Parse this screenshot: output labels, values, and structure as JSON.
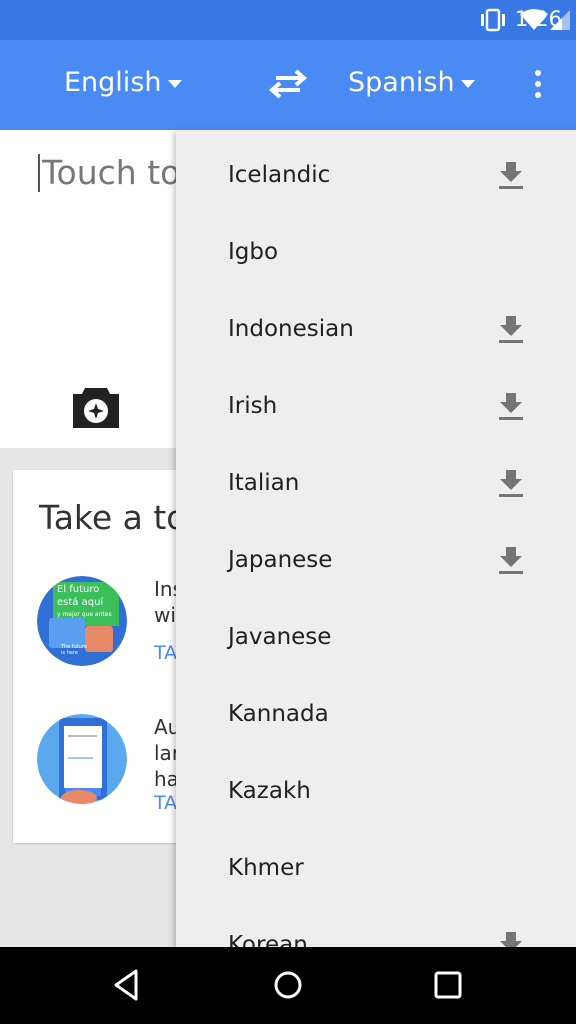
{
  "status_bar": {
    "time": "1:26",
    "icons": [
      "vibrate-icon",
      "wifi-icon",
      "cell-signal-icon",
      "battery-icon"
    ]
  },
  "app_bar": {
    "source_language": "English",
    "target_language": "Spanish",
    "icons": [
      "swap-icon",
      "more-vert-icon"
    ],
    "color": "#4a8af4"
  },
  "input": {
    "placeholder": "Touch to"
  },
  "tour": {
    "title": "Take a to",
    "items": [
      {
        "text": "Ins\nwi",
        "link": "TA",
        "thumb_text": [
          "El futuro",
          "está aquí",
          "y mejor que antes"
        ]
      },
      {
        "text": "Au\nlar\nha",
        "link": "TA"
      }
    ]
  },
  "dropdown": {
    "items": [
      {
        "label": "Icelandic",
        "download": true
      },
      {
        "label": "Igbo",
        "download": false
      },
      {
        "label": "Indonesian",
        "download": true
      },
      {
        "label": "Irish",
        "download": true
      },
      {
        "label": "Italian",
        "download": true
      },
      {
        "label": "Japanese",
        "download": true
      },
      {
        "label": "Javanese",
        "download": false
      },
      {
        "label": "Kannada",
        "download": false
      },
      {
        "label": "Kazakh",
        "download": false
      },
      {
        "label": "Khmer",
        "download": false
      },
      {
        "label": "Korean",
        "download": true
      }
    ]
  },
  "nav_bar": {
    "icons": [
      "back-icon",
      "home-icon",
      "recents-icon"
    ]
  }
}
